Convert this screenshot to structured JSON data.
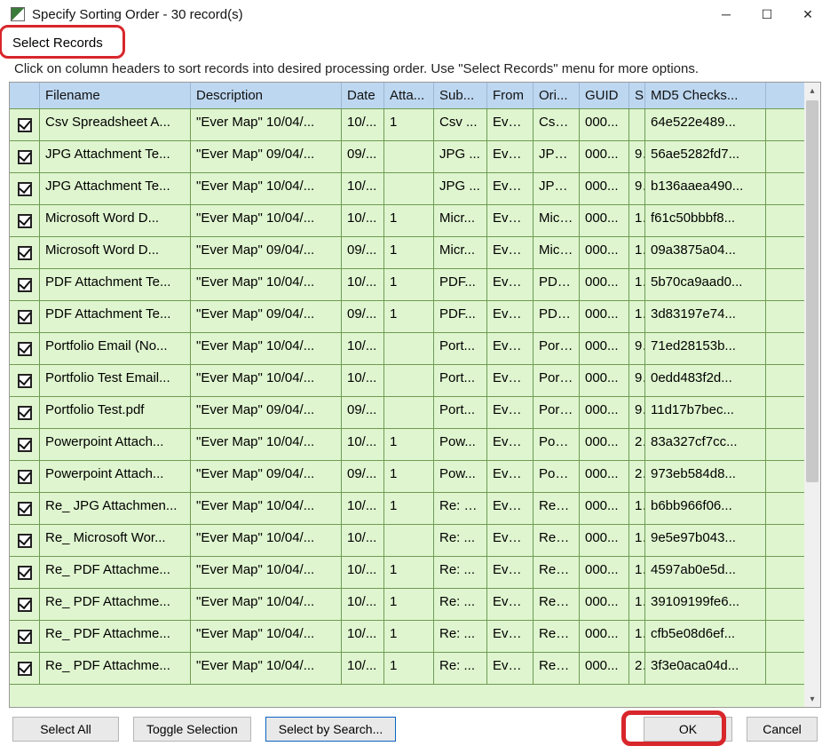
{
  "window": {
    "title": "Specify Sorting Order - 30 record(s)"
  },
  "menu": {
    "select_records": "Select Records"
  },
  "hint": "Click on column headers to sort records into desired processing order. Use \"Select Records\" menu for more options.",
  "columns": {
    "filename": "Filename",
    "description": "Description",
    "date": "Date",
    "atta": "Atta...",
    "sub": "Sub...",
    "from": "From",
    "ori": "Ori...",
    "guid": "GUID",
    "s": "S",
    "md5": "MD5 Checks..."
  },
  "rows": [
    {
      "checked": true,
      "filename": "Csv Spreadsheet A...",
      "description": "\"Ever Map\" 10/04/...",
      "date": "10/...",
      "atta": "1",
      "sub": "Csv ...",
      "from": "Ever...",
      "ori": "Csv ...",
      "guid": "000...",
      "s": "",
      "md5": "64e522e489..."
    },
    {
      "checked": true,
      "filename": "JPG Attachment Te...",
      "description": "\"Ever Map\" 09/04/...",
      "date": "09/...",
      "atta": "",
      "sub": "JPG ...",
      "from": "Ever...",
      "ori": "JPG ...",
      "guid": "000...",
      "s": "9",
      "md5": "56ae5282fd7..."
    },
    {
      "checked": true,
      "filename": "JPG Attachment Te...",
      "description": "\"Ever Map\" 10/04/...",
      "date": "10/...",
      "atta": "",
      "sub": "JPG ...",
      "from": "Ever...",
      "ori": "JPG ...",
      "guid": "000...",
      "s": "9",
      "md5": "b136aaea490..."
    },
    {
      "checked": true,
      "filename": "Microsoft Word D...",
      "description": "\"Ever Map\" 10/04/...",
      "date": "10/...",
      "atta": "1",
      "sub": "Micr...",
      "from": "Ever...",
      "ori": "Micr...",
      "guid": "000...",
      "s": "1",
      "md5": "f61c50bbbf8..."
    },
    {
      "checked": true,
      "filename": "Microsoft Word D...",
      "description": "\"Ever Map\" 09/04/...",
      "date": "09/...",
      "atta": "1",
      "sub": "Micr...",
      "from": "Ever...",
      "ori": "Micr...",
      "guid": "000...",
      "s": "1",
      "md5": "09a3875a04..."
    },
    {
      "checked": true,
      "filename": "PDF Attachment Te...",
      "description": "\"Ever Map\" 10/04/...",
      "date": "10/...",
      "atta": "1",
      "sub": "PDF...",
      "from": "Ever...",
      "ori": "PDF...",
      "guid": "000...",
      "s": "1",
      "md5": "5b70ca9aad0..."
    },
    {
      "checked": true,
      "filename": "PDF Attachment Te...",
      "description": "\"Ever Map\" 09/04/...",
      "date": "09/...",
      "atta": "1",
      "sub": "PDF...",
      "from": "Ever...",
      "ori": "PDF...",
      "guid": "000...",
      "s": "1",
      "md5": "3d83197e74..."
    },
    {
      "checked": true,
      "filename": "Portfolio Email (No...",
      "description": "\"Ever Map\" 10/04/...",
      "date": "10/...",
      "atta": "",
      "sub": "Port...",
      "from": "Ever...",
      "ori": "Port...",
      "guid": "000...",
      "s": "9",
      "md5": "71ed28153b..."
    },
    {
      "checked": true,
      "filename": "Portfolio Test Email...",
      "description": "\"Ever Map\" 10/04/...",
      "date": "10/...",
      "atta": "",
      "sub": "Port...",
      "from": "Ever...",
      "ori": "Port...",
      "guid": "000...",
      "s": "9",
      "md5": "0edd483f2d..."
    },
    {
      "checked": true,
      "filename": "Portfolio Test.pdf",
      "description": "\"Ever Map\" 09/04/...",
      "date": "09/...",
      "atta": "",
      "sub": "Port...",
      "from": "Ever...",
      "ori": "Port...",
      "guid": "000...",
      "s": "9",
      "md5": "11d17b7bec..."
    },
    {
      "checked": true,
      "filename": "Powerpoint Attach...",
      "description": "\"Ever Map\" 10/04/...",
      "date": "10/...",
      "atta": "1",
      "sub": "Pow...",
      "from": "Ever...",
      "ori": "Pow...",
      "guid": "000...",
      "s": "2",
      "md5": "83a327cf7cc..."
    },
    {
      "checked": true,
      "filename": "Powerpoint Attach...",
      "description": "\"Ever Map\" 09/04/...",
      "date": "09/...",
      "atta": "1",
      "sub": "Pow...",
      "from": "Ever...",
      "ori": "Pow...",
      "guid": "000...",
      "s": "2",
      "md5": "973eb584d8..."
    },
    {
      "checked": true,
      "filename": "Re_ JPG Attachmen...",
      "description": "\"Ever Map\" 10/04/...",
      "date": "10/...",
      "atta": "1",
      "sub": "Re: J...",
      "from": "Ever...",
      "ori": "Re_ ...",
      "guid": "000...",
      "s": "1",
      "md5": "b6bb966f06..."
    },
    {
      "checked": true,
      "filename": "Re_ Microsoft Wor...",
      "description": "\"Ever Map\" 10/04/...",
      "date": "10/...",
      "atta": "",
      "sub": "Re: ...",
      "from": "Ever...",
      "ori": "Re_ ...",
      "guid": "000...",
      "s": "1",
      "md5": "9e5e97b043..."
    },
    {
      "checked": true,
      "filename": "Re_ PDF Attachme...",
      "description": "\"Ever Map\" 10/04/...",
      "date": "10/...",
      "atta": "1",
      "sub": "Re: ...",
      "from": "Ever...",
      "ori": "Re_ ...",
      "guid": "000...",
      "s": "1",
      "md5": "4597ab0e5d..."
    },
    {
      "checked": true,
      "filename": "Re_ PDF Attachme...",
      "description": "\"Ever Map\" 10/04/...",
      "date": "10/...",
      "atta": "1",
      "sub": "Re: ...",
      "from": "Ever...",
      "ori": "Re_ ...",
      "guid": "000...",
      "s": "1",
      "md5": "39109199fe6..."
    },
    {
      "checked": true,
      "filename": "Re_ PDF Attachme...",
      "description": "\"Ever Map\" 10/04/...",
      "date": "10/...",
      "atta": "1",
      "sub": "Re: ...",
      "from": "Ever...",
      "ori": "Re_ ...",
      "guid": "000...",
      "s": "1",
      "md5": "cfb5e08d6ef..."
    },
    {
      "checked": true,
      "filename": "Re_ PDF Attachme...",
      "description": "\"Ever Map\" 10/04/...",
      "date": "10/...",
      "atta": "1",
      "sub": "Re: ...",
      "from": "Ever...",
      "ori": "Re_ ...",
      "guid": "000...",
      "s": "2",
      "md5": "3f3e0aca04d..."
    }
  ],
  "buttons": {
    "select_all": "Select All",
    "toggle_selection": "Toggle Selection",
    "select_by_search": "Select by Search...",
    "ok": "OK",
    "cancel": "Cancel"
  }
}
